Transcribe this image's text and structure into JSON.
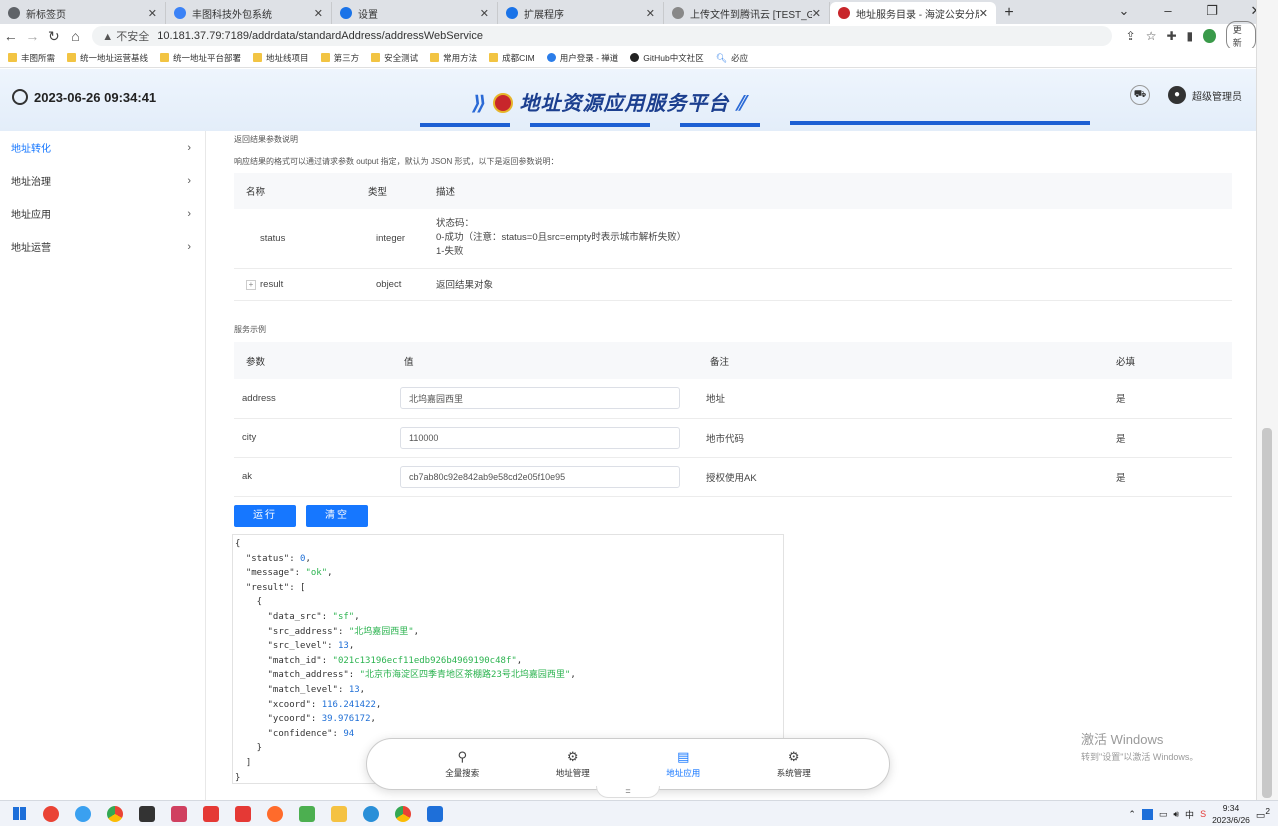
{
  "browser": {
    "tabs": [
      {
        "title": "新标签页",
        "color": "#5f6368"
      },
      {
        "title": "丰图科技外包系统",
        "color": "#3b82f6"
      },
      {
        "title": "设置",
        "color": "#1a73e8"
      },
      {
        "title": "扩展程序",
        "color": "#1a73e8"
      },
      {
        "title": "上传文件到腾讯云 [TEST_GROUP",
        "color": "#666"
      },
      {
        "title": "地址服务目录 - 海淀公安分局",
        "color": "#c8262b"
      }
    ],
    "new_tab": "+",
    "warning": "▲ 不安全",
    "url": "10.181.37.79:7189/addrdata/standardAddress/addressWebService",
    "update_label": "更新",
    "bookmarks": [
      "丰图所需",
      "统一地址运营基线",
      "统一地址平台部署",
      "地址线项目",
      "第三方",
      "安全测试",
      "常用方法",
      "成都CIM",
      "用户登录 - 禅道",
      "GitHub中文社区",
      "必应"
    ]
  },
  "header": {
    "datetime": "2023-06-26 09:34:41",
    "title": "地址资源应用服务平台",
    "user": "超级管理员"
  },
  "sidebar": {
    "items": [
      {
        "label": "地址转化",
        "active": true
      },
      {
        "label": "地址治理",
        "active": false
      },
      {
        "label": "地址应用",
        "active": false
      },
      {
        "label": "地址运营",
        "active": false
      }
    ]
  },
  "result_params": {
    "title": "返回结果参数说明",
    "desc": "响应结果的格式可以通过请求参数 output 指定，默认为 JSON 形式，以下是返回参数说明：",
    "headers": {
      "name": "名称",
      "type": "类型",
      "desc": "描述"
    },
    "rows": [
      {
        "name": "status",
        "type": "integer",
        "d1": "状态码：",
        "d2": "0-成功（注意：status=0且src=empty时表示城市解析失败）",
        "d3": "1-失败"
      },
      {
        "name": "result",
        "type": "object",
        "d1": "返回结果对象"
      }
    ]
  },
  "example": {
    "title": "服务示例",
    "headers": {
      "param": "参数",
      "value": "值",
      "note": "备注",
      "required": "必填"
    },
    "rows": [
      {
        "param": "address",
        "value": "北坞嘉园西里",
        "note": "地址",
        "required": "是"
      },
      {
        "param": "city",
        "value": "110000",
        "note": "地市代码",
        "required": "是"
      },
      {
        "param": "ak",
        "value": "cb7ab80c92e842ab9e58cd2e05f10e95",
        "note": "授权使用AK",
        "required": "是"
      }
    ],
    "run_label": "运行",
    "clear_label": "清空"
  },
  "json_output": {
    "status": "0",
    "message": "\"ok\"",
    "data_src": "\"sf\"",
    "src_address": "\"北坞嘉园西里\"",
    "src_level": "13",
    "match_id": "\"021c13196ecf11edb926b4969190c48f\"",
    "match_address": "\"北京市海淀区四季青地区茶棚路23号北坞嘉园西里\"",
    "match_level": "13",
    "xcoord": "116.241422",
    "ycoord": "39.976172",
    "confidence": "94"
  },
  "dock": [
    {
      "label": "全量搜索",
      "icon": "search-icon"
    },
    {
      "label": "地址管理",
      "icon": "gear-icon"
    },
    {
      "label": "地址应用",
      "icon": "doc-icon",
      "active": true
    },
    {
      "label": "系统管理",
      "icon": "gear-icon"
    }
  ],
  "watermark": {
    "line1": "激活 Windows",
    "line2": "转到\"设置\"以激活 Windows。"
  },
  "taskbar": {
    "time": "9:34",
    "date": "2023/6/26",
    "notify": "2"
  }
}
